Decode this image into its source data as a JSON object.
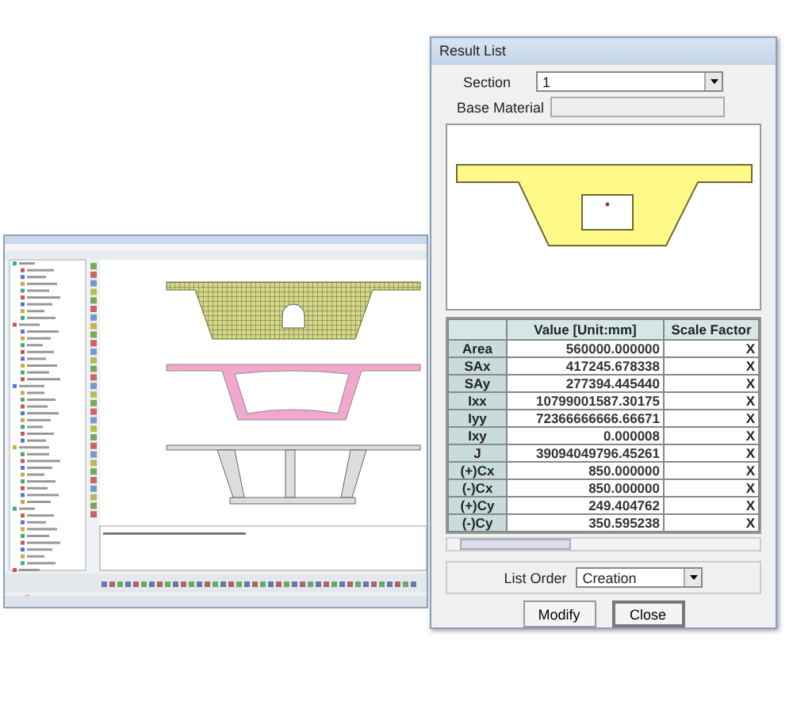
{
  "dialog": {
    "title": "Result List",
    "section": {
      "label": "Section",
      "value": "1"
    },
    "base_material": {
      "label": "Base Material"
    },
    "table": {
      "columns": [
        "Value [Unit:mm]",
        "Scale Factor"
      ],
      "rows": [
        {
          "name": "Area",
          "value": "560000.000000",
          "scale": "X"
        },
        {
          "name": "SAx",
          "value": "417245.678338",
          "scale": "X"
        },
        {
          "name": "SAy",
          "value": "277394.445440",
          "scale": "X"
        },
        {
          "name": "Ixx",
          "value": "10799001587.30175",
          "scale": "X"
        },
        {
          "name": "Iyy",
          "value": "72366666666.66671",
          "scale": "X"
        },
        {
          "name": "Ixy",
          "value": "0.000008",
          "scale": "X"
        },
        {
          "name": "J",
          "value": "39094049796.45261",
          "scale": "X"
        },
        {
          "name": "(+)Cx",
          "value": "850.000000",
          "scale": "X"
        },
        {
          "name": "(-)Cx",
          "value": "850.000000",
          "scale": "X"
        },
        {
          "name": "(+)Cy",
          "value": "249.404762",
          "scale": "X"
        },
        {
          "name": "(-)Cy",
          "value": "350.595238",
          "scale": "X"
        }
      ]
    },
    "list_order": {
      "label": "List Order",
      "value": "Creation"
    },
    "buttons": [
      {
        "label": "Modify",
        "focused": false
      },
      {
        "label": "Close",
        "focused": true
      }
    ]
  }
}
